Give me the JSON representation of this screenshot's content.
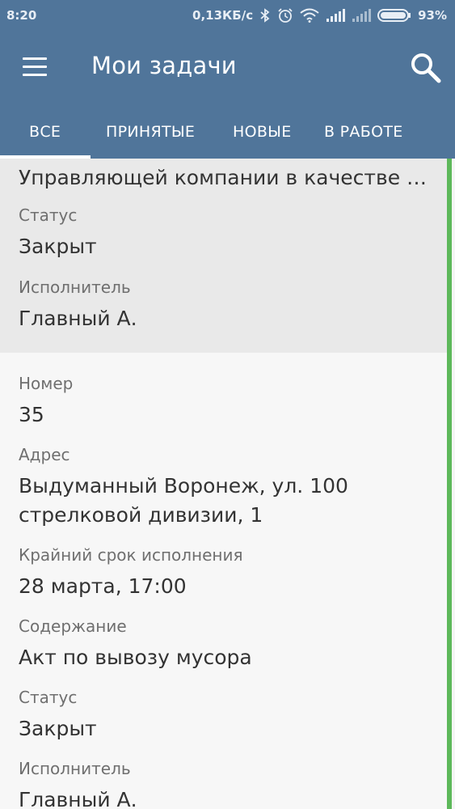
{
  "status_bar": {
    "time": "8:20",
    "speed": "0,13КБ/с",
    "battery": "93%",
    "icons": [
      "bluetooth-icon",
      "alarm-icon",
      "wifi-icon",
      "signal-icon",
      "signal-weak-icon",
      "battery-icon"
    ]
  },
  "toolbar": {
    "title": "Мои задачи"
  },
  "tabs": [
    {
      "label": "ВСЕ",
      "active": true
    },
    {
      "label": "ПРИНЯТЫЕ",
      "active": false
    },
    {
      "label": "НОВЫЕ",
      "active": false
    },
    {
      "label": "В РАБОТЕ",
      "active": false
    }
  ],
  "task_prev": {
    "content_partial": "Управляющей компании в качестве д...",
    "status_label": "Статус",
    "status_value": "Закрыт",
    "executor_label": "Исполнитель",
    "executor_value": "Главный А."
  },
  "task": {
    "number_label": "Номер",
    "number_value": "35",
    "address_label": "Адрес",
    "address_value": "Выдуманный Воронеж, ул. 100 стрелковой дивизии, 1",
    "deadline_label": "Крайний срок исполнения",
    "deadline_value": "28 марта, 17:00",
    "content_label": "Содержание",
    "content_value": "Акт по вывозу мусора",
    "status_label": "Статус",
    "status_value": "Закрыт",
    "executor_label": "Исполнитель",
    "executor_value": "Главный А."
  },
  "colors": {
    "appbar": "#50759a",
    "accent_scroll": "#5db85a"
  }
}
